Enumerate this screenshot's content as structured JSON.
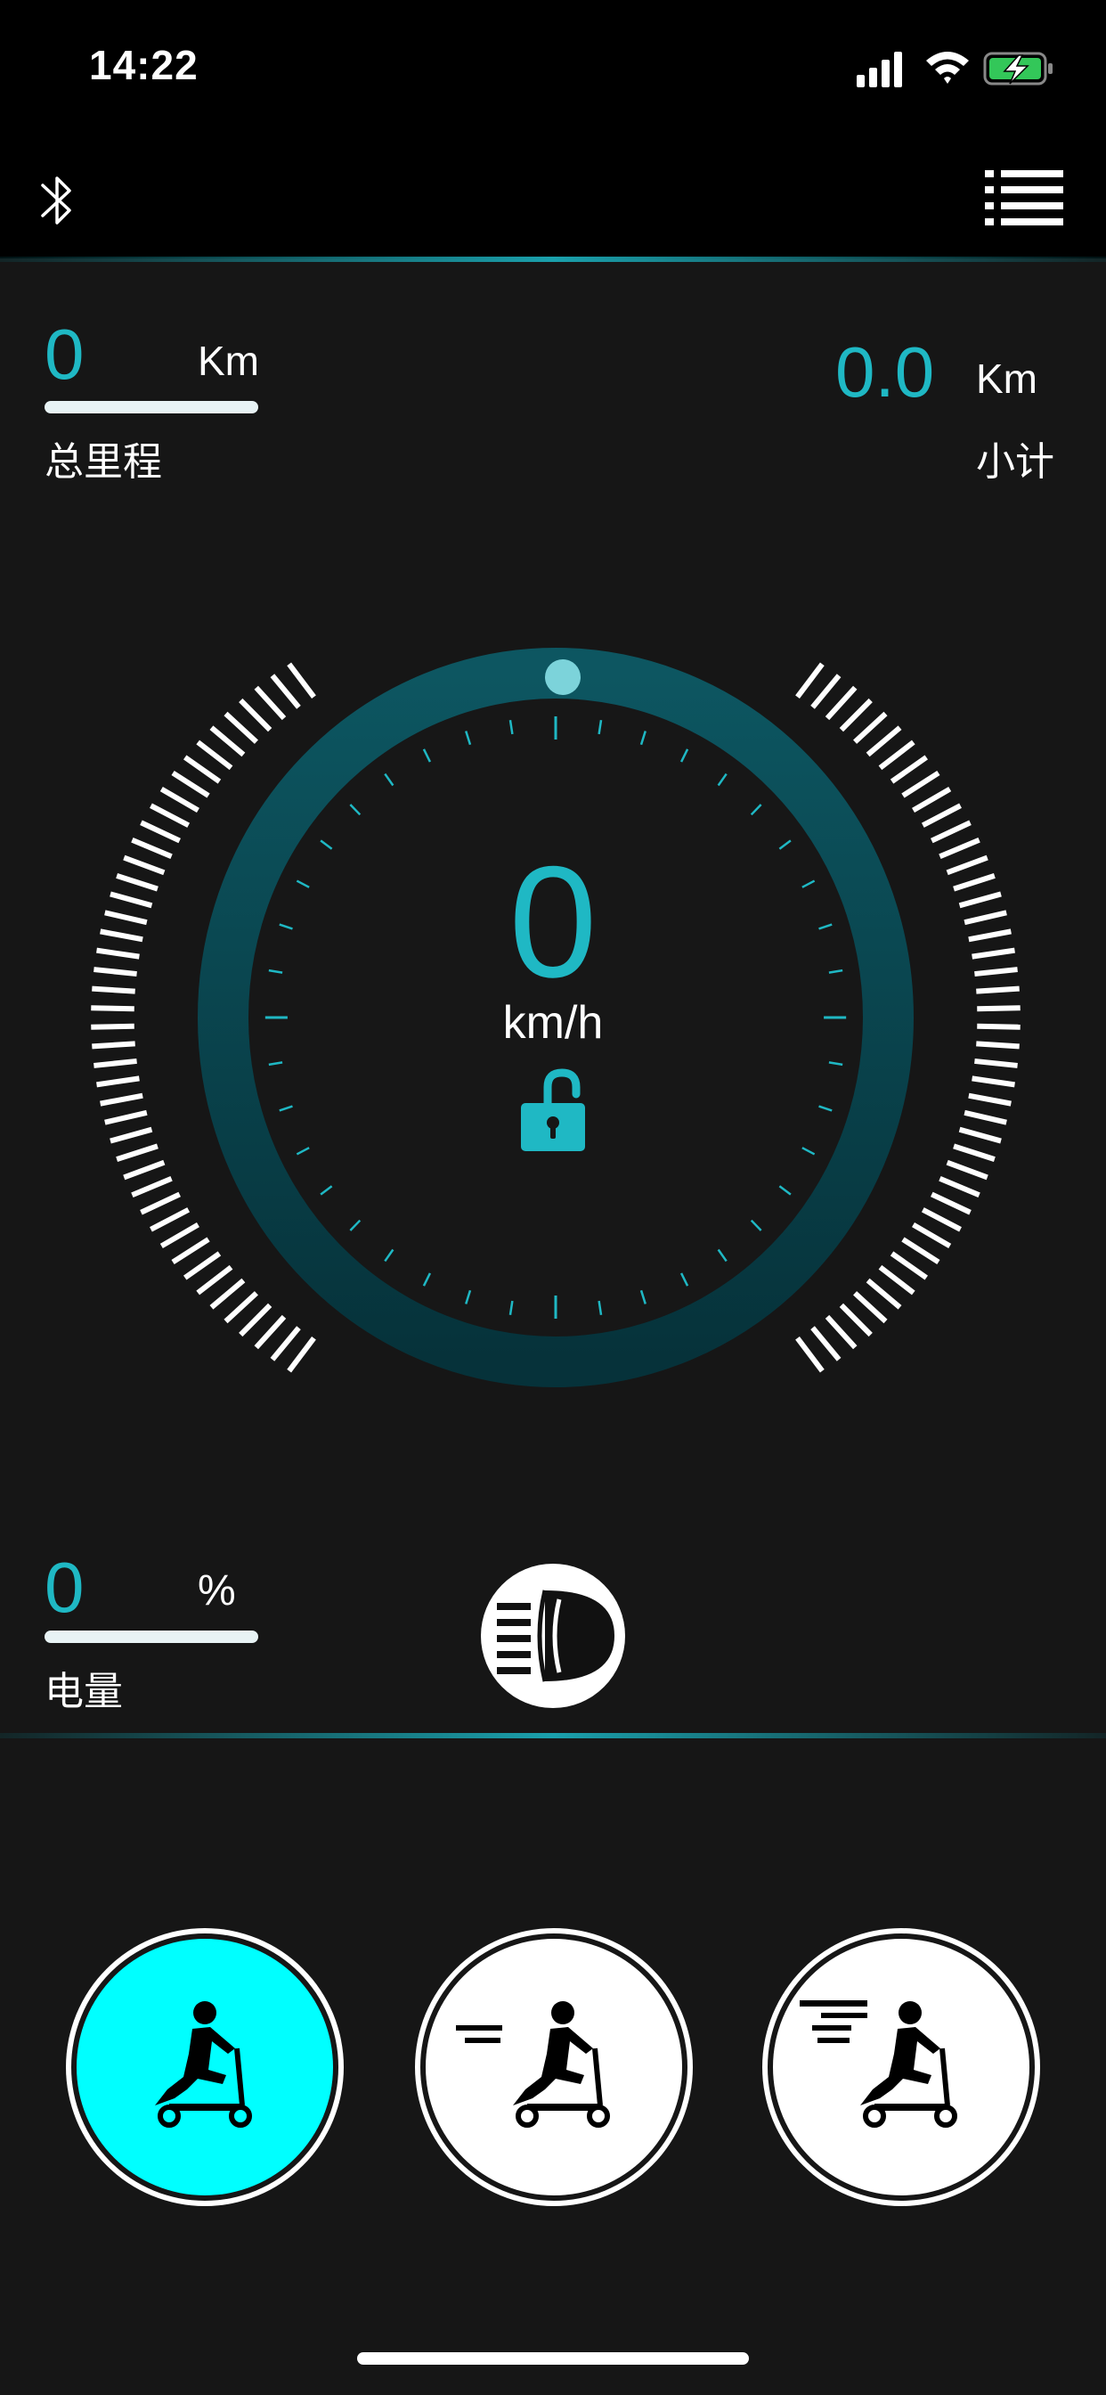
{
  "status_bar": {
    "time": "14:22",
    "icons": [
      "signal-icon",
      "wifi-icon",
      "battery-charging-icon"
    ]
  },
  "toolbar": {
    "left_icon": "bluetooth-icon",
    "right_icon": "list-menu-icon"
  },
  "odometer": {
    "total_value": "0",
    "total_unit": "Km",
    "total_label": "总里程",
    "trip_value": "0.0",
    "trip_unit": "Km",
    "trip_label": "小计"
  },
  "speedometer": {
    "speed_value": "0",
    "speed_unit": "km/h",
    "lock_icon": "unlocked-padlock-icon"
  },
  "battery": {
    "value": "0",
    "unit": "%",
    "label": "电量"
  },
  "headlight": {
    "icon": "headlight-icon"
  },
  "modes": [
    {
      "icon": "scooter-rider-icon",
      "selected": true
    },
    {
      "icon": "scooter-rider-medium-speed-icon",
      "selected": false
    },
    {
      "icon": "scooter-rider-high-speed-icon",
      "selected": false
    }
  ],
  "colors": {
    "accent": "#1fb8c4",
    "mode_selected": "#00ffff",
    "background": "#161616"
  }
}
